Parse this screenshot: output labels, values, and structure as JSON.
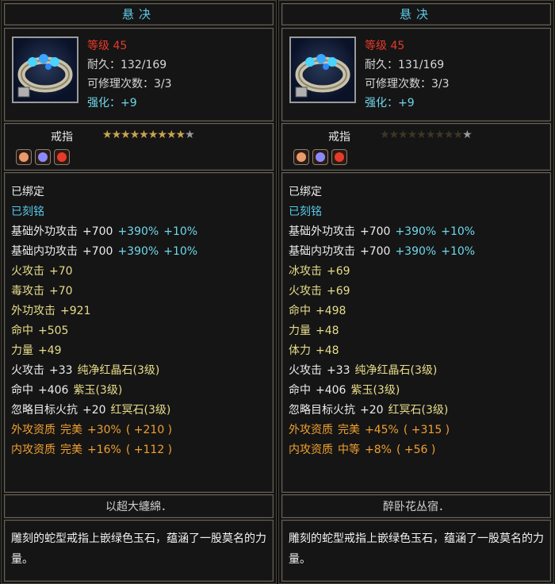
{
  "tooltips": [
    {
      "title": "悬决",
      "level": "等级 45",
      "durability": "耐久：132/169",
      "repair": "可修理次数：3/3",
      "enhance_label": "强化：",
      "enhance_value": "+9",
      "item_type": "戒指",
      "stars_lit": 9,
      "stars_total": 10,
      "gem_colors": [
        "#e89a6a",
        "#8a8aff",
        "#e83a2a"
      ],
      "bound": "已绑定",
      "engraved": "已刻铭",
      "stats": [
        {
          "label": "基础外功攻击",
          "v1": "+700",
          "v2": "+390%",
          "v3": "+10%",
          "color": "white"
        },
        {
          "label": "基础内功攻击",
          "v1": "+700",
          "v2": "+390%",
          "v3": "+10%",
          "color": "white"
        },
        {
          "label": "火攻击",
          "v1": "+70",
          "color": "gold"
        },
        {
          "label": "毒攻击",
          "v1": "+70",
          "color": "gold"
        },
        {
          "label": "外功攻击",
          "v1": "+921",
          "color": "gold"
        },
        {
          "label": "命中",
          "v1": "+505",
          "color": "gold"
        },
        {
          "label": "力量",
          "v1": "+49",
          "color": "gold"
        },
        {
          "label": "火攻击",
          "v1": "+33",
          "gem": "纯净红晶石(3级)",
          "color": "white"
        },
        {
          "label": "命中",
          "v1": "+406",
          "gem": "紫玉(3级)",
          "color": "white"
        },
        {
          "label": "忽略目标火抗",
          "v1": "+20",
          "gem": "红冥石(3级)",
          "color": "white"
        },
        {
          "label": "外攻资质",
          "v1": "完美",
          "v2": "+30%",
          "v3": "( +210 )",
          "color": "orange"
        },
        {
          "label": "内攻资质",
          "v1": "完美",
          "v2": "+16%",
          "v3": "( +112 )",
          "color": "orange"
        }
      ],
      "crafter": "以超大纏綿．",
      "description": "雕刻的蛇型戒指上嵌绿色玉石，蕴涵了一股莫名的力量。"
    },
    {
      "title": "悬决",
      "level": "等级 45",
      "durability": "耐久：131/169",
      "repair": "可修理次数：3/3",
      "enhance_label": "强化：",
      "enhance_value": "+9",
      "item_type": "戒指",
      "stars_lit": 0,
      "stars_total": 10,
      "gem_colors": [
        "#e89a6a",
        "#8a8aff",
        "#e83a2a"
      ],
      "bound": "已绑定",
      "engraved": "已刻铭",
      "stats": [
        {
          "label": "基础外功攻击",
          "v1": "+700",
          "v2": "+390%",
          "v3": "+10%",
          "color": "white"
        },
        {
          "label": "基础内功攻击",
          "v1": "+700",
          "v2": "+390%",
          "v3": "+10%",
          "color": "white"
        },
        {
          "label": "冰攻击",
          "v1": "+69",
          "color": "gold"
        },
        {
          "label": "火攻击",
          "v1": "+69",
          "color": "gold"
        },
        {
          "label": "命中",
          "v1": "+498",
          "color": "gold"
        },
        {
          "label": "力量",
          "v1": "+48",
          "color": "gold"
        },
        {
          "label": "体力",
          "v1": "+48",
          "color": "gold"
        },
        {
          "label": "火攻击",
          "v1": "+33",
          "gem": "纯净红晶石(3级)",
          "color": "white"
        },
        {
          "label": "命中",
          "v1": "+406",
          "gem": "紫玉(3级)",
          "color": "white"
        },
        {
          "label": "忽略目标火抗",
          "v1": "+20",
          "gem": "红冥石(3级)",
          "color": "white"
        },
        {
          "label": "外攻资质",
          "v1": "完美",
          "v2": "+45%",
          "v3": "( +315 )",
          "color": "orange"
        },
        {
          "label": "内攻资质",
          "v1": "中等",
          "v2": "+8%",
          "v3": "( +56 )",
          "color": "orange"
        }
      ],
      "crafter": "醉卧花丛宿．",
      "description": "雕刻的蛇型戒指上嵌绿色玉石，蕴涵了一股莫名的力量。"
    }
  ]
}
